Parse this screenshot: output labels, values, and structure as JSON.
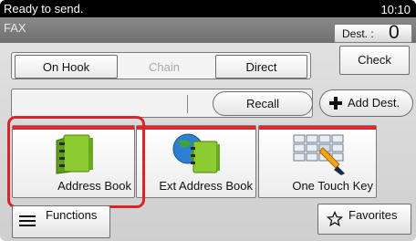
{
  "status": {
    "message": "Ready to send.",
    "time": "10:10"
  },
  "header": {
    "mode": "FAX",
    "dest_label": "Dest. :",
    "dest_count": "0"
  },
  "mode_buttons": {
    "on_hook": "On Hook",
    "chain": "Chain",
    "direct": "Direct"
  },
  "check_label": "Check",
  "destination": {
    "recall_label": "Recall",
    "add_dest_label": "Add Dest."
  },
  "tiles": [
    {
      "label": "Address Book",
      "icon": "address-book-icon"
    },
    {
      "label": "Ext Address Book",
      "icon": "ext-address-book-icon"
    },
    {
      "label": "One Touch Key",
      "icon": "one-touch-key-icon"
    }
  ],
  "bottom": {
    "functions_label": "Functions",
    "favorites_label": "Favorites"
  },
  "colors": {
    "accent_red": "#e3262b",
    "highlight_red": "#d9242a",
    "status_bar": "#000000",
    "disabled_text": "#a8a8a8"
  }
}
